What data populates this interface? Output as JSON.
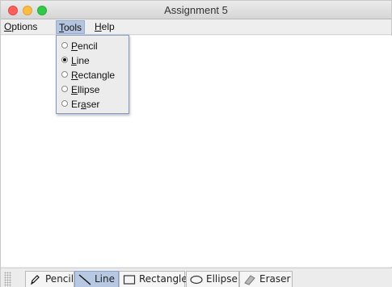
{
  "window": {
    "title": "Assignment 5"
  },
  "menubar": {
    "options": "Options",
    "tools": "Tools",
    "help": "Help"
  },
  "tools_menu": {
    "items": [
      {
        "label": "Pencil",
        "mnemonic_before": "",
        "mnemonic": "P",
        "rest": "encil",
        "selected": false
      },
      {
        "label": "Line",
        "mnemonic_before": "",
        "mnemonic": "L",
        "rest": "ine",
        "selected": true
      },
      {
        "label": "Rectangle",
        "mnemonic_before": "",
        "mnemonic": "R",
        "rest": "ectangle",
        "selected": false
      },
      {
        "label": "Ellipse",
        "mnemonic_before": "",
        "mnemonic": "E",
        "rest": "llipse",
        "selected": false
      },
      {
        "label": "Eraser",
        "mnemonic_before": "Er",
        "mnemonic": "a",
        "rest": "ser",
        "selected": false
      }
    ]
  },
  "toolbar": {
    "pencil": "Pencil",
    "line": "Line",
    "rectangle": "Rectangle",
    "ellipse": "Ellipse",
    "eraser": "Eraser",
    "selected_tool": "line"
  }
}
